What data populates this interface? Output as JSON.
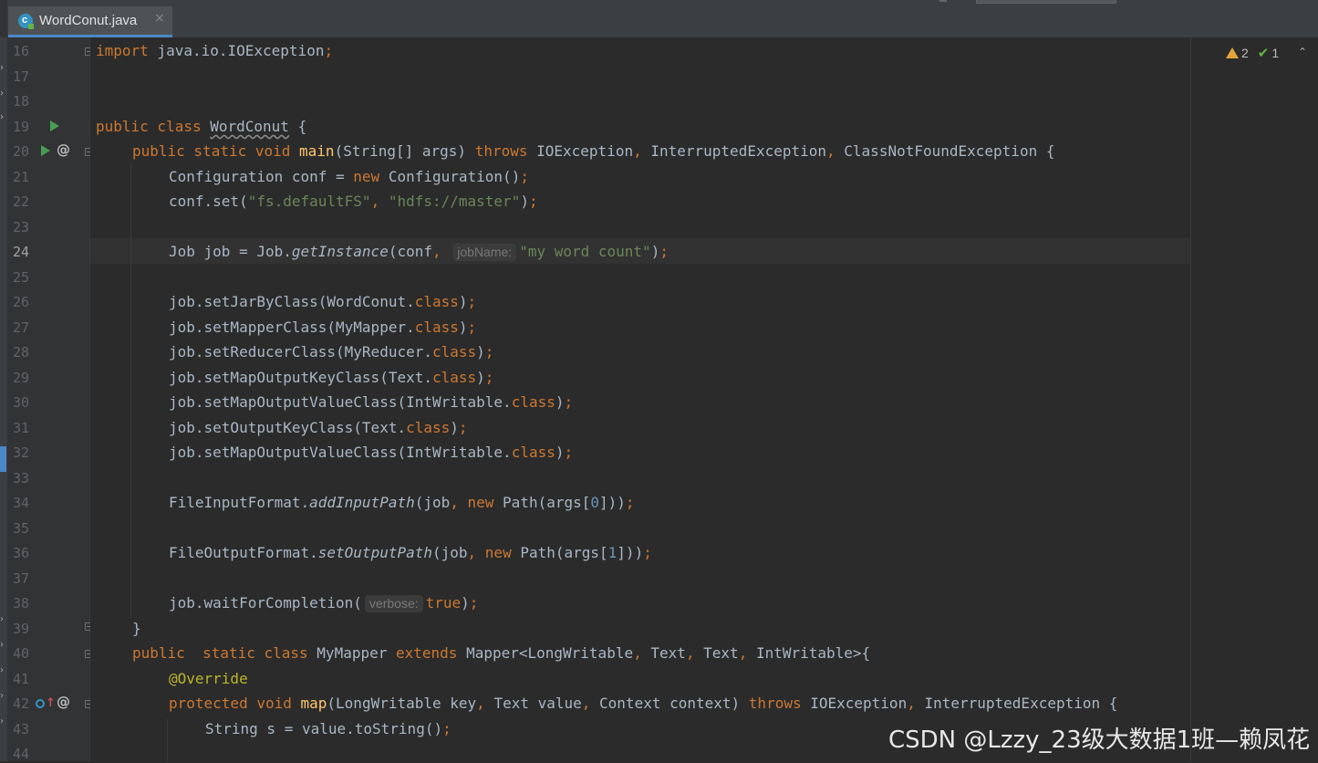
{
  "tab": {
    "title": "WordConut.java",
    "close": "×",
    "icon": "java-class-icon",
    "icon_letter": "c"
  },
  "inspection": {
    "warnings": "2",
    "weak_warnings": "1",
    "chevron": "⌃"
  },
  "gutter": {
    "line_numbers": [
      "16",
      "17",
      "18",
      "19",
      "20",
      "21",
      "22",
      "23",
      "24",
      "25",
      "26",
      "27",
      "28",
      "29",
      "30",
      "31",
      "32",
      "33",
      "34",
      "35",
      "36",
      "37",
      "38",
      "39",
      "40",
      "41",
      "42",
      "43",
      "44"
    ],
    "current_line": "24"
  },
  "code": {
    "l16": {
      "t1": "import",
      "t2": " java.io.IOException",
      "t3": ";"
    },
    "l19": {
      "t1": "public class ",
      "t2": "WordConut",
      "t3": " {"
    },
    "l20": {
      "t1": "public static void ",
      "t2": "main",
      "t3": "(String[] args) ",
      "t4": "throws ",
      "t5": "IOException",
      "t6": ", ",
      "t7": "InterruptedException",
      "t8": ", ",
      "t9": "ClassNotFoundException {"
    },
    "l21": {
      "t1": "Configuration conf = ",
      "t2": "new ",
      "t3": "Configuration()",
      "t4": ";"
    },
    "l22": {
      "t1": "conf.set(",
      "t2": "\"fs.defaultFS\"",
      "t3": ", ",
      "t4": "\"hdfs://master\"",
      "t5": ")",
      "t6": ";"
    },
    "l24": {
      "t1": "Job job = Job.",
      "t2": "getInstance",
      "t3": "(conf",
      "t4": ", ",
      "hint": "jobName:",
      "t5": "\"my word count\"",
      "t6": ")",
      "t7": ";"
    },
    "l26": {
      "t1": "job.setJarByClass(WordConut.",
      "t2": "class",
      "t3": ")",
      "t4": ";"
    },
    "l27": {
      "t1": "job.setMapperClass(MyMapper.",
      "t2": "class",
      "t3": ")",
      "t4": ";"
    },
    "l28": {
      "t1": "job.setReducerClass(MyReducer.",
      "t2": "class",
      "t3": ")",
      "t4": ";"
    },
    "l29": {
      "t1": "job.setMapOutputKeyClass(Text.",
      "t2": "class",
      "t3": ")",
      "t4": ";"
    },
    "l30": {
      "t1": "job.setMapOutputValueClass(IntWritable.",
      "t2": "class",
      "t3": ")",
      "t4": ";"
    },
    "l31": {
      "t1": "job.setOutputKeyClass(Text.",
      "t2": "class",
      "t3": ")",
      "t4": ";"
    },
    "l32": {
      "t1": "job.setMapOutputValueClass(IntWritable.",
      "t2": "class",
      "t3": ")",
      "t4": ";"
    },
    "l34": {
      "t1": "FileInputFormat.",
      "t2": "addInputPath",
      "t3": "(job",
      "t4": ", ",
      "t5": "new ",
      "t6": "Path(args[",
      "t7": "0",
      "t8": "]))",
      "t9": ";"
    },
    "l36": {
      "t1": "FileOutputFormat.",
      "t2": "setOutputPath",
      "t3": "(job",
      "t4": ", ",
      "t5": "new ",
      "t6": "Path(args[",
      "t7": "1",
      "t8": "]))",
      "t9": ";"
    },
    "l38": {
      "t1": "job.waitForCompletion(",
      "hint": "verbose:",
      "t2": "true",
      "t3": ")",
      "t4": ";"
    },
    "l39": {
      "t1": "}"
    },
    "l40": {
      "t1": "public  static class ",
      "t2": "MyMapper ",
      "t3": "extends ",
      "t4": "Mapper<LongWritable",
      "t5": ", ",
      "t6": "Text",
      "t7": ", ",
      "t8": "Text",
      "t9": ", ",
      "t10": "IntWritable>{"
    },
    "l41": {
      "t1": "@Override"
    },
    "l42": {
      "t1": "protected void ",
      "t2": "map",
      "t3": "(LongWritable key",
      "t4": ", ",
      "t5": "Text value",
      "t6": ", ",
      "t7": "Context context) ",
      "t8": "throws ",
      "t9": "IOException",
      "t10": ", ",
      "t11": "InterruptedException {"
    },
    "l43": {
      "t1": "String s = value.toString()",
      "t2": ";"
    }
  },
  "watermark": "CSDN @Lzzy_23级大数据1班—赖凤花",
  "colors": {
    "keyword": "#cc7832",
    "function": "#ffc66d",
    "string": "#6a8759",
    "number": "#6897bb",
    "annotation": "#bbb529",
    "text": "#a9b7c6",
    "background": "#2b2b2b"
  }
}
